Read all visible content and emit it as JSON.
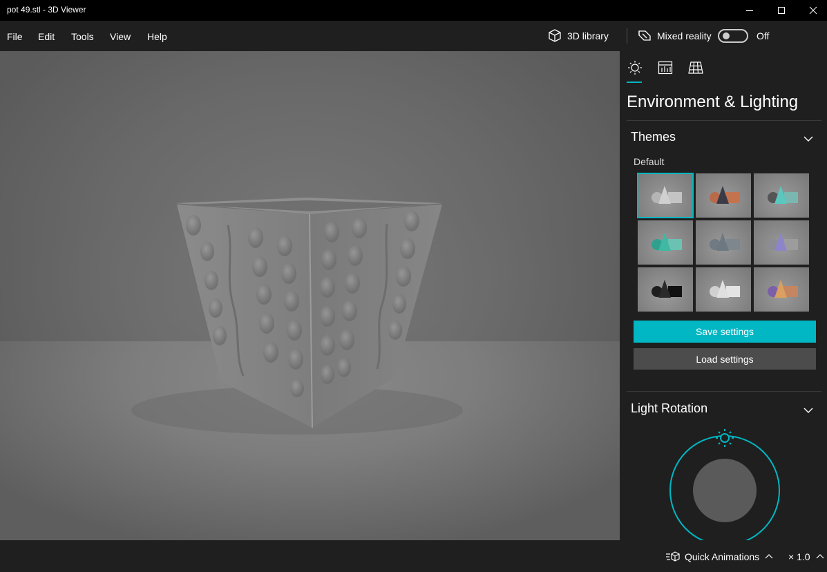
{
  "window": {
    "title": "pot 49.stl - 3D Viewer"
  },
  "menu": {
    "items": [
      "File",
      "Edit",
      "Tools",
      "View",
      "Help"
    ]
  },
  "toolbar": {
    "library_label": "3D library",
    "mixed_reality_label": "Mixed reality",
    "mixed_reality_state": "Off"
  },
  "panel": {
    "tabs": [
      {
        "icon": "sun-icon"
      },
      {
        "icon": "stats-icon"
      },
      {
        "icon": "grid-icon"
      }
    ],
    "title": "Environment & Lighting",
    "themes": {
      "heading": "Themes",
      "group_label": "Default",
      "items": [
        {
          "ball": "#b5b5b5",
          "cone": "#d0d0d0",
          "box": "#c4c4c4",
          "selected": true
        },
        {
          "ball": "#b86a4a",
          "cone": "#3b3b48",
          "box": "#c4734f",
          "selected": false
        },
        {
          "ball": "#555555",
          "cone": "#5ac8be",
          "box": "#7ab7b0",
          "selected": false
        },
        {
          "ball": "#2fa08e",
          "cone": "#3fb8a4",
          "box": "#6bc2b3",
          "selected": false
        },
        {
          "ball": "#6f7a82",
          "cone": "#6c7980",
          "box": "#7d878d",
          "selected": false
        },
        {
          "ball": "#8c8c95",
          "cone": "#8c85c9",
          "box": "#9c9c9c",
          "selected": false
        },
        {
          "ball": "#1e1e1e",
          "cone": "#2a2a2a",
          "box": "#111111",
          "selected": false
        },
        {
          "ball": "#d0d0d0",
          "cone": "#e0e0e0",
          "box": "#e4e4e4",
          "selected": false
        },
        {
          "ball": "#7b5fa8",
          "cone": "#d9a060",
          "box": "#c48560",
          "selected": false
        }
      ],
      "save_label": "Save settings",
      "load_label": "Load settings"
    },
    "light_rotation": {
      "heading": "Light Rotation"
    }
  },
  "bottom": {
    "quick_animations_label": "Quick Animations",
    "speed_label": "× 1.0"
  },
  "colors": {
    "accent": "#00b7c3",
    "panel_bg": "#1f1f1f",
    "titlebar_bg": "#000000"
  }
}
